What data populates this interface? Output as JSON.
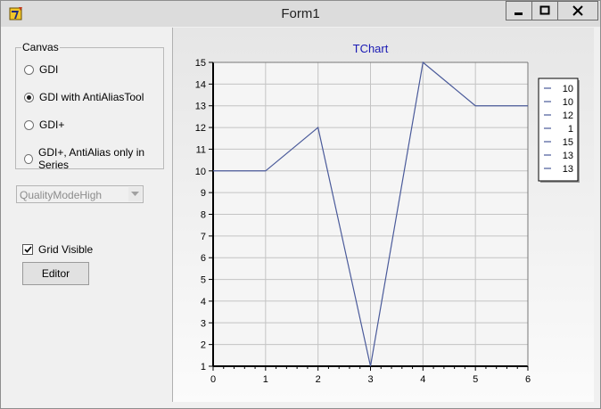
{
  "window": {
    "title": "Form1",
    "icon": "delphi-app-icon"
  },
  "caption_buttons": {
    "minimize": "minimize-icon",
    "maximize": "maximize-icon",
    "close": "close-icon"
  },
  "canvas_group": {
    "label": "Canvas",
    "options": [
      {
        "label": "GDI",
        "selected": false
      },
      {
        "label": "GDI with AntiAliasTool",
        "selected": true
      },
      {
        "label": "GDI+",
        "selected": false
      },
      {
        "label": "GDI+, AntiAlias only in Series",
        "selected": false
      }
    ]
  },
  "quality_combo": {
    "value": "QualityModeHigh",
    "enabled": false
  },
  "grid_visible": {
    "label": "Grid Visible",
    "checked": true
  },
  "editor_button": {
    "label": "Editor"
  },
  "chart_data": {
    "type": "line",
    "title": "TChart",
    "xlabel": "",
    "ylabel": "",
    "x": [
      0,
      1,
      2,
      3,
      4,
      5,
      6
    ],
    "values": [
      10,
      10,
      12,
      1,
      15,
      13,
      13
    ],
    "xlim": [
      0,
      6
    ],
    "ylim": [
      1,
      15
    ],
    "xticks": [
      0,
      1,
      2,
      3,
      4,
      5,
      6
    ],
    "yticks": [
      1,
      2,
      3,
      4,
      5,
      6,
      7,
      8,
      9,
      10,
      11,
      12,
      13,
      14,
      15
    ],
    "grid": true,
    "legend": {
      "placement": "right",
      "entries": [
        "10",
        "10",
        "12",
        "1",
        "15",
        "13",
        "13"
      ]
    },
    "colors": {
      "line": "#4a5a9a",
      "title": "#1a1ab4",
      "grid": "#c4c4c4",
      "axis": "#000000"
    }
  }
}
